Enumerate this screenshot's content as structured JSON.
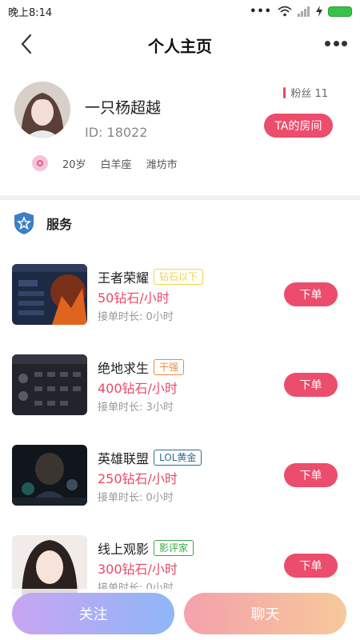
{
  "status_bar": {
    "time": "晚上8:14",
    "icons": [
      "more-dots-icon",
      "wifi-icon",
      "signal-icon",
      "charging-icon",
      "battery-icon"
    ]
  },
  "header": {
    "title": "个人主页",
    "back_icon": "chevron-left-icon",
    "more_icon": "more-horizontal-icon"
  },
  "profile": {
    "name": "一只杨超越",
    "id_text": "ID: 18022",
    "fans_text": "粉丝 11",
    "room_button": "TA的房间",
    "tags": {
      "age": "20岁",
      "zodiac": "白羊座",
      "city": "潍坊市"
    }
  },
  "services": {
    "title": "服务",
    "items": [
      {
        "name": "王者荣耀",
        "badge": "钻石以下",
        "badge_color": "#f2d34a",
        "price": "50钻石/小时",
        "duration": "接单时长: 0小时",
        "button": "下单",
        "thumb": "game-screenshot"
      },
      {
        "name": "绝地求生",
        "badge": "干强",
        "badge_color": "#ee8a3c",
        "price": "400钻石/小时",
        "duration": "接单时长: 3小时",
        "button": "下单",
        "thumb": "game-screenshot"
      },
      {
        "name": "英雄联盟",
        "badge": "LOL黄金",
        "badge_color": "#2f6e8e",
        "price": "250钻石/小时",
        "duration": "接单时长: 0小时",
        "button": "下单",
        "thumb": "game-screenshot"
      },
      {
        "name": "线上观影",
        "badge": "影评家",
        "badge_color": "#3aa84a",
        "price": "300钻石/小时",
        "duration": "接单时长: 0小时",
        "button": "下单",
        "thumb": "portrait-photo"
      }
    ]
  },
  "bottom": {
    "follow": "关注",
    "chat": "聊天"
  },
  "colors": {
    "accent": "#ec4d6c",
    "price": "#e84a67"
  }
}
